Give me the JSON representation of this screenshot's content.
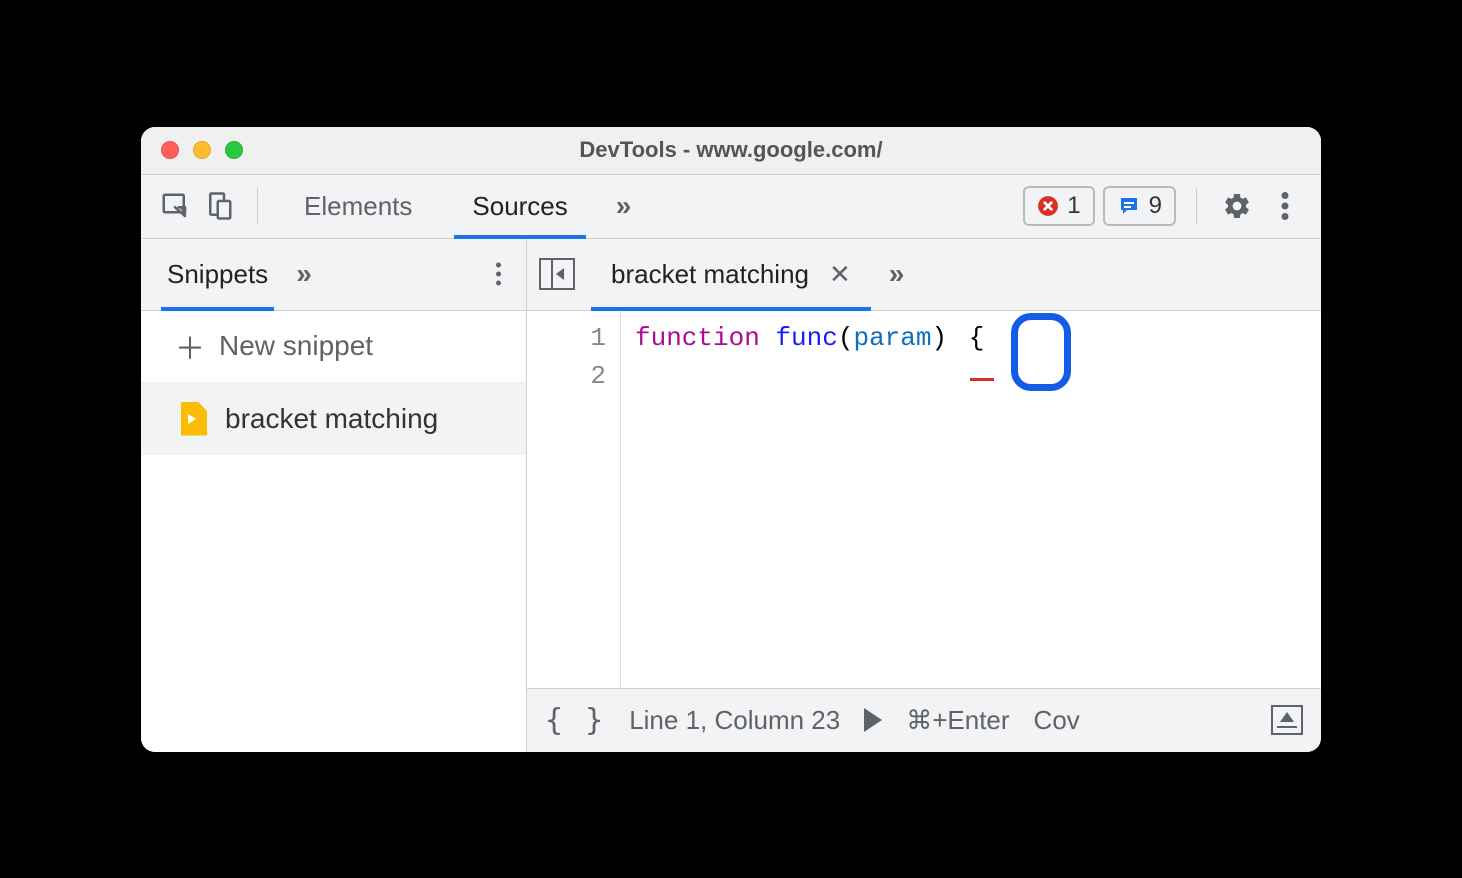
{
  "window": {
    "title": "DevTools - www.google.com/"
  },
  "toolbar": {
    "tabs": [
      {
        "label": "Elements",
        "active": false
      },
      {
        "label": "Sources",
        "active": true
      }
    ],
    "errors_count": "1",
    "messages_count": "9"
  },
  "sidebar": {
    "active_tab": "Snippets",
    "new_snippet_label": "New snippet",
    "files": [
      {
        "name": "bracket matching",
        "selected": true
      }
    ]
  },
  "editor": {
    "tabs": [
      {
        "label": "bracket matching",
        "active": true
      }
    ],
    "gutter": [
      "1",
      "2"
    ],
    "code": {
      "keyword": "function",
      "func_name": "func",
      "open_paren": "(",
      "param": "param",
      "close_paren": ")",
      "space": " ",
      "brace": "{"
    }
  },
  "statusbar": {
    "braces": "{ }",
    "cursor_position": "Line 1, Column 23",
    "run_shortcut": "⌘+Enter",
    "coverage_truncated": "Cov"
  }
}
